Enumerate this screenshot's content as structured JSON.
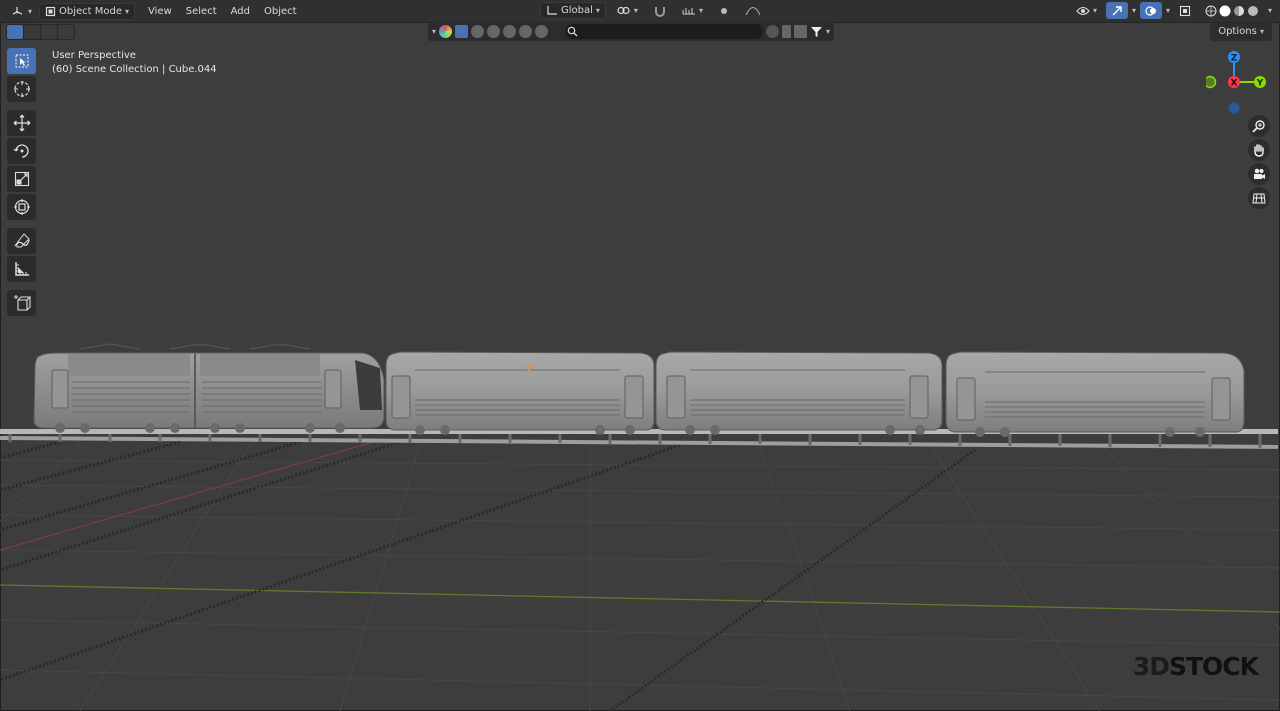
{
  "header": {
    "editor_type_icon": "3d-viewport-icon",
    "mode_label": "Object Mode",
    "menus": [
      "View",
      "Select",
      "Add",
      "Object"
    ],
    "transform_orientation": "Global"
  },
  "toolbar_right": {
    "options_label": "Options"
  },
  "search": {
    "placeholder": ""
  },
  "viewport": {
    "perspective_label": "User Perspective",
    "collection_label": "(60) Scene Collection | Cube.044"
  },
  "gizmo": {
    "z_label": "Z",
    "x_label": "X",
    "y_label": "Y"
  },
  "tools": [
    {
      "name": "select-box-tool",
      "icon": "cursor-icon",
      "active": true
    },
    {
      "name": "cursor-tool",
      "icon": "crosshair-icon",
      "active": false
    },
    {
      "name": "move-tool",
      "icon": "move-arrows-icon",
      "active": false
    },
    {
      "name": "rotate-tool",
      "icon": "rotate-icon",
      "active": false
    },
    {
      "name": "scale-tool",
      "icon": "scale-icon",
      "active": false
    },
    {
      "name": "transform-tool",
      "icon": "transform-icon",
      "active": false
    },
    {
      "name": "annotate-tool",
      "icon": "pencil-icon",
      "active": false
    },
    {
      "name": "measure-tool",
      "icon": "ruler-icon",
      "active": false
    },
    {
      "name": "add-cube-tool",
      "icon": "add-cube-icon",
      "active": false
    }
  ],
  "watermark": {
    "brand_a": "3D",
    "brand_b": "STOCK"
  },
  "colors": {
    "accent": "#4772b3",
    "x_axis": "#ff3352",
    "y_axis": "#8bdc00",
    "z_axis": "#2890ff",
    "viewport_bg": "#3d3d3d"
  }
}
